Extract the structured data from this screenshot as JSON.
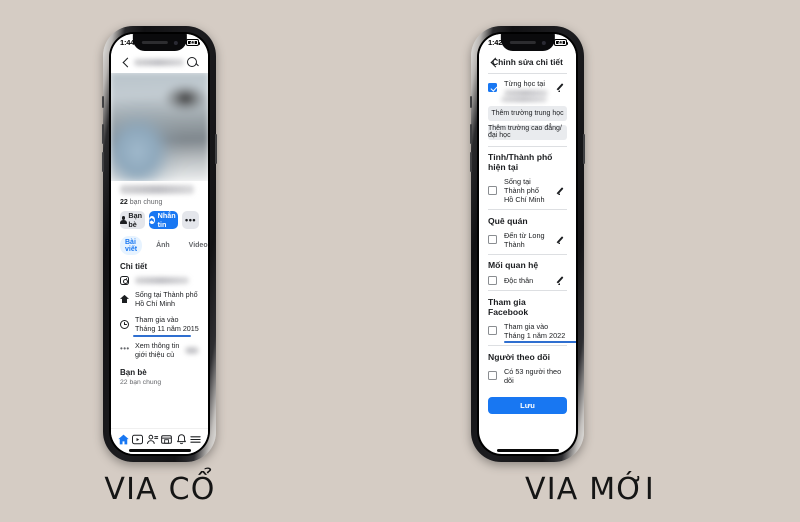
{
  "background_color": "#d5ccc4",
  "accent_color": "#1877f2",
  "captions": {
    "left": "VIA CỔ",
    "right": "VIA MỚI"
  },
  "left_phone": {
    "status_bar": {
      "time": "1:44",
      "network": "LTE",
      "battery": "43"
    },
    "topbar": {
      "back_icon": "chevron-left-icon",
      "title_blurred": "",
      "search_icon": "search-icon"
    },
    "profile": {
      "name_blurred": "",
      "mutual_count": "22",
      "mutual_label": "bạn chung",
      "buttons": {
        "friend": "Bạn bè",
        "message": "Nhắn tin",
        "more": "•••"
      },
      "tabs": [
        {
          "label": "Bài viết",
          "active": true
        },
        {
          "label": "Ảnh",
          "active": false
        },
        {
          "label": "Video",
          "active": false
        }
      ]
    },
    "details": {
      "title": "Chi tiết",
      "rows": [
        {
          "icon": "instagram-icon",
          "text": "",
          "blurred": true,
          "underlined": false
        },
        {
          "icon": "home-icon",
          "text": "Sống tại Thành phố Hồ Chí Minh",
          "blurred": false,
          "underlined": false
        },
        {
          "icon": "clock-icon",
          "text": "Tham gia vào Tháng 11 năm 2015",
          "blurred": false,
          "underlined": true
        },
        {
          "icon": "ellipsis-icon",
          "text": "Xem thông tin giới thiệu củ",
          "blurred": true,
          "underlined": false
        }
      ]
    },
    "friends_section": {
      "title": "Bạn bè",
      "subtitle": "22 bạn chung"
    },
    "navbar": [
      {
        "icon": "home-icon",
        "active": true
      },
      {
        "icon": "watch-video-icon",
        "active": false
      },
      {
        "icon": "friends-icon",
        "active": false
      },
      {
        "icon": "marketplace-icon",
        "active": false
      },
      {
        "icon": "bell-notification-icon",
        "active": false
      },
      {
        "icon": "hamburger-menu-icon",
        "active": false
      }
    ]
  },
  "right_phone": {
    "status_bar": {
      "time": "1:42",
      "network": "LTE",
      "battery": "43"
    },
    "topbar": {
      "back_icon": "chevron-left-icon",
      "title": "Chỉnh sửa chi tiết"
    },
    "education": {
      "checkbox_checked": true,
      "label": "Từng học tại",
      "label_blurred_suffix": "",
      "edit_icon": "pencil-edit-icon",
      "add_highschool": "Thêm trường trung học",
      "add_college": "Thêm trường cao đẳng/đại học"
    },
    "sections": [
      {
        "title": "Tỉnh/Thành phố hiện tại",
        "checkbox_checked": false,
        "item": "Sống tại Thành phố Hồ Chí Minh",
        "edit_icon": "pencil-edit-icon",
        "underlined": false
      },
      {
        "title": "Quê quán",
        "checkbox_checked": false,
        "item": "Đến từ Long Thành",
        "edit_icon": "pencil-edit-icon",
        "underlined": false
      },
      {
        "title": "Mối quan hệ",
        "checkbox_checked": false,
        "item": "Độc thân",
        "edit_icon": "pencil-edit-icon",
        "underlined": false
      },
      {
        "title": "Tham gia Facebook",
        "checkbox_checked": false,
        "item": "Tham gia vào Tháng 1 năm 2022",
        "edit_icon": "",
        "underlined": true
      },
      {
        "title": "Người theo dõi",
        "checkbox_checked": false,
        "item": "Có 53 người theo dõi",
        "edit_icon": "",
        "underlined": false
      }
    ],
    "save_button": "Lưu"
  }
}
